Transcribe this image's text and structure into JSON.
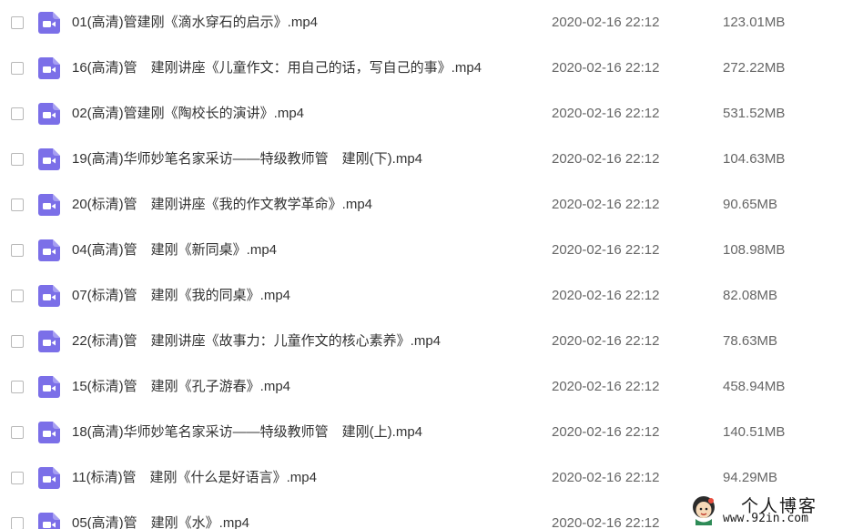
{
  "colors": {
    "icon_accent": "#7b6fe8",
    "icon_glyph": "#ffffff",
    "text_primary": "#333333",
    "text_secondary": "#666666"
  },
  "files": [
    {
      "name": "01(高清)管建刚《滴水穿石的启示》.mp4",
      "date": "2020-02-16 22:12",
      "size": "123.01MB",
      "icon": "video-file-icon"
    },
    {
      "name": "16(高清)管　建刚讲座《儿童作文：用自己的话，写自己的事》.mp4",
      "date": "2020-02-16 22:12",
      "size": "272.22MB",
      "icon": "video-file-icon"
    },
    {
      "name": "02(高清)管建刚《陶校长的演讲》.mp4",
      "date": "2020-02-16 22:12",
      "size": "531.52MB",
      "icon": "video-file-icon"
    },
    {
      "name": "19(高清)华师妙笔名家采访——特级教师管　建刚(下).mp4",
      "date": "2020-02-16 22:12",
      "size": "104.63MB",
      "icon": "video-file-icon"
    },
    {
      "name": "20(标清)管　建刚讲座《我的作文教学革命》.mp4",
      "date": "2020-02-16 22:12",
      "size": "90.65MB",
      "icon": "video-file-icon"
    },
    {
      "name": "04(高清)管　建刚《新同桌》.mp4",
      "date": "2020-02-16 22:12",
      "size": "108.98MB",
      "icon": "video-file-icon"
    },
    {
      "name": "07(标清)管　建刚《我的同桌》.mp4",
      "date": "2020-02-16 22:12",
      "size": "82.08MB",
      "icon": "video-file-icon"
    },
    {
      "name": "22(标清)管　建刚讲座《故事力：儿童作文的核心素养》.mp4",
      "date": "2020-02-16 22:12",
      "size": "78.63MB",
      "icon": "video-file-icon"
    },
    {
      "name": "15(标清)管　建刚《孔子游春》.mp4",
      "date": "2020-02-16 22:12",
      "size": "458.94MB",
      "icon": "video-file-icon"
    },
    {
      "name": "18(高清)华师妙笔名家采访——特级教师管　建刚(上).mp4",
      "date": "2020-02-16 22:12",
      "size": "140.51MB",
      "icon": "video-file-icon"
    },
    {
      "name": "11(标清)管　建刚《什么是好语言》.mp4",
      "date": "2020-02-16 22:12",
      "size": "94.29MB",
      "icon": "video-file-icon"
    },
    {
      "name": "05(高清)管　建刚《水》.mp4",
      "date": "2020-02-16 22:12",
      "size": "",
      "icon": "video-file-icon"
    }
  ],
  "watermark": {
    "title": "个人博客",
    "url": "www.92in.com"
  }
}
